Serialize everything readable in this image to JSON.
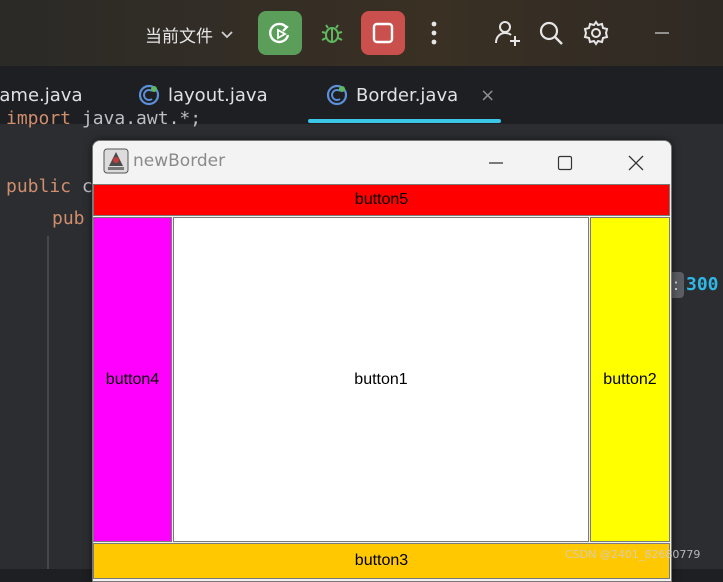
{
  "toolbar": {
    "run_config_label": "当前文件",
    "icons": [
      "chevron-down-icon",
      "rerun-icon",
      "bug-icon",
      "stop-icon",
      "more-vertical-icon",
      "add-user-icon",
      "search-icon",
      "gear-icon",
      "minimize-icon"
    ],
    "colors": {
      "run_bg": "#5a9e5a",
      "stop_bg": "#c9504c"
    }
  },
  "tabs": [
    {
      "label": "rame.java"
    },
    {
      "label": "layout.java"
    },
    {
      "label": "Border.java",
      "active": true,
      "close": "×"
    }
  ],
  "editor": {
    "line1_kw": "import",
    "line1_text": " java.awt.*;",
    "line2_kw": "public",
    "line2_text": " c",
    "line3_kw": "pub",
    "inlay_value": "300",
    "gutter_badge": ":"
  },
  "window": {
    "title": "newBorder",
    "buttons": {
      "north": {
        "label": "button5",
        "color": "#ff0000"
      },
      "west": {
        "label": "button4",
        "color": "#ff00ff"
      },
      "center": {
        "label": "button1",
        "color": "#ffffff"
      },
      "east": {
        "label": "button2",
        "color": "#ffff00"
      },
      "south": {
        "label": "button3",
        "color": "#ffc800"
      }
    }
  },
  "watermark": "CSDN @2401_82680779"
}
